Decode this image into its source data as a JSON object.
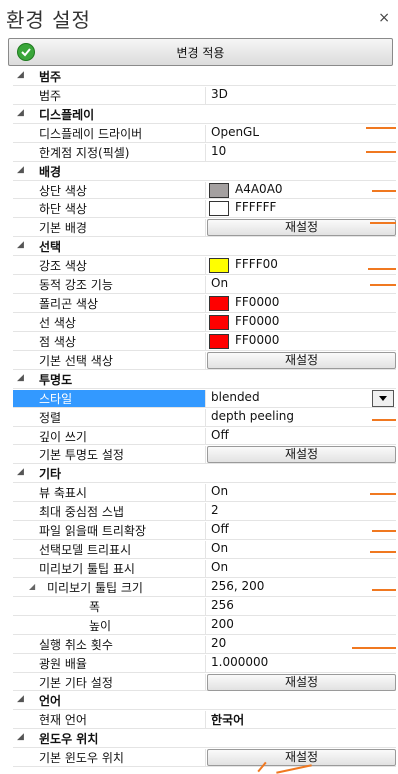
{
  "window": {
    "title": "환경 설정",
    "close_glyph": "×"
  },
  "apply_button": {
    "label": "변경 적용",
    "icon": "check-circle-icon"
  },
  "colors": {
    "selection": "#3399ff",
    "annotation": "#f07820"
  },
  "grid": {
    "category": {
      "header": "범주",
      "label": "범주",
      "value": "3D"
    },
    "display": {
      "header": "디스플레이",
      "driver_label": "디스플레이 드라이버",
      "driver_value": "OpenGL",
      "threshold_label": "한계점 지정(픽셀)",
      "threshold_value": "10"
    },
    "background": {
      "header": "배경",
      "top_label": "상단 색상",
      "top_value": "A4A0A0",
      "top_color": "#a4a0a0",
      "bottom_label": "하단 색상",
      "bottom_value": "FFFFFF",
      "bottom_color": "#ffffff",
      "default_label": "기본 배경",
      "reset": "재설정"
    },
    "selection": {
      "header": "선택",
      "highlight_label": "강조 색상",
      "highlight_value": "FFFF00",
      "highlight_color": "#ffff00",
      "dynamic_label": "동적 강조 기능",
      "dynamic_value": "On",
      "polygon_label": "폴리곤 색상",
      "polygon_value": "FF0000",
      "polygon_color": "#ff0000",
      "line_label": "선 색상",
      "line_value": "FF0000",
      "line_color": "#ff0000",
      "point_label": "점 색상",
      "point_value": "FF0000",
      "point_color": "#ff0000",
      "default_label": "기본 선택 색상",
      "reset": "재설정"
    },
    "transparency": {
      "header": "투명도",
      "style_label": "스타일",
      "style_value": "blended",
      "sort_label": "정렬",
      "sort_value": "depth peeling",
      "depth_label": "깊이 쓰기",
      "depth_value": "Off",
      "default_label": "기본 투명도 설정",
      "reset": "재설정"
    },
    "misc": {
      "header": "기타",
      "axis_label": "뷰 축표시",
      "axis_value": "On",
      "snap_label": "최대 중심점 스냅",
      "snap_value": "2",
      "tree_label": "파일 읽을때 트리확장",
      "tree_value": "Off",
      "seltree_label": "선택모델 트리표시",
      "seltree_value": "On",
      "tooltip_label": "미리보기 툴팁 표시",
      "tooltip_value": "On",
      "tipsize_label": "미리보기 툴팁 크기",
      "tipsize_value": "256, 200",
      "width_label": "폭",
      "width_value": "256",
      "height_label": "높이",
      "height_value": "200",
      "undo_label": "실행 취소 횟수",
      "undo_value": "20",
      "light_label": "광원 배율",
      "light_value": "1.000000",
      "default_label": "기본 기타 설정",
      "reset": "재설정"
    },
    "language": {
      "header": "언어",
      "current_label": "현재 언어",
      "current_value": "한국어"
    },
    "window_pos": {
      "header": "윈도우 위치",
      "default_label": "기본 윈도우 위치",
      "reset": "재설정"
    }
  }
}
